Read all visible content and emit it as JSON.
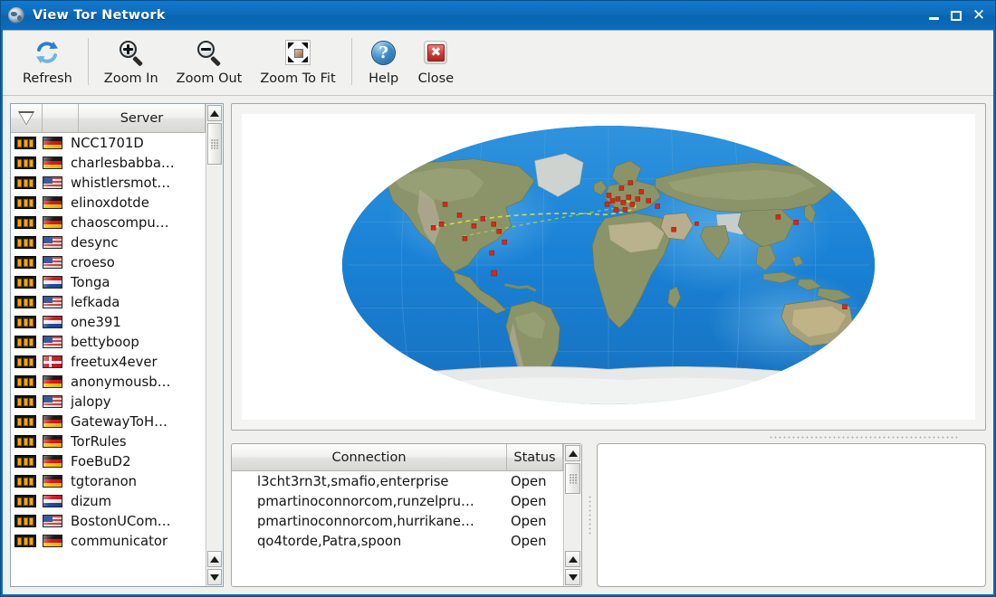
{
  "window": {
    "title": "View Tor Network",
    "icon": "globe-icon",
    "controls": {
      "minimize": "–",
      "maximize": "□",
      "close": "✕"
    },
    "titlebar_color": "#0e6cbb"
  },
  "toolbar": {
    "items": [
      {
        "label": "Refresh",
        "icon": "refresh-icon"
      },
      {
        "label": "Zoom In",
        "icon": "zoom-in-icon"
      },
      {
        "label": "Zoom Out",
        "icon": "zoom-out-icon"
      },
      {
        "label": "Zoom To Fit",
        "icon": "zoom-to-fit-icon"
      },
      {
        "label": "Help",
        "icon": "help-icon"
      },
      {
        "label": "Close",
        "icon": "close-icon"
      }
    ]
  },
  "server_list": {
    "columns": {
      "filter": "",
      "flag": "",
      "server": "Server"
    },
    "filter_icon": "filter-triangle-icon",
    "rows": [
      {
        "server": "NCC1701D",
        "flag": "de",
        "bandwidth": 3
      },
      {
        "server": "charlesbabba…",
        "flag": "de",
        "bandwidth": 3
      },
      {
        "server": "whistlersmot…",
        "flag": "us",
        "bandwidth": 3
      },
      {
        "server": "elinoxdotde",
        "flag": "de",
        "bandwidth": 3
      },
      {
        "server": "chaoscompu…",
        "flag": "de",
        "bandwidth": 3
      },
      {
        "server": "desync",
        "flag": "us",
        "bandwidth": 3
      },
      {
        "server": "croeso",
        "flag": "us",
        "bandwidth": 3
      },
      {
        "server": "Tonga",
        "flag": "nl",
        "bandwidth": 3
      },
      {
        "server": "lefkada",
        "flag": "us",
        "bandwidth": 3
      },
      {
        "server": "one391",
        "flag": "nl",
        "bandwidth": 3
      },
      {
        "server": "bettyboop",
        "flag": "us",
        "bandwidth": 3
      },
      {
        "server": "freetux4ever",
        "flag": "dk",
        "bandwidth": 3
      },
      {
        "server": "anonymousb…",
        "flag": "de",
        "bandwidth": 3
      },
      {
        "server": "jalopy",
        "flag": "us",
        "bandwidth": 3
      },
      {
        "server": "GatewayToH…",
        "flag": "de",
        "bandwidth": 3
      },
      {
        "server": "TorRules",
        "flag": "de",
        "bandwidth": 3
      },
      {
        "server": "FoeBuD2",
        "flag": "de",
        "bandwidth": 3
      },
      {
        "server": "tgtoranon",
        "flag": "de",
        "bandwidth": 3
      },
      {
        "server": "dizum",
        "flag": "nl",
        "bandwidth": 3
      },
      {
        "server": "BostonUCom…",
        "flag": "us",
        "bandwidth": 3
      },
      {
        "server": "communicator",
        "flag": "de",
        "bandwidth": 3
      }
    ],
    "scrollbar": {
      "up": "▲",
      "down": "▼"
    }
  },
  "map": {
    "name": "world-map",
    "projection": "robinson",
    "ocean_color": "#1a7fd4",
    "land_color": "#7f8f62",
    "marker_color": "#d42a18",
    "background": "#ffffff"
  },
  "connections": {
    "columns": {
      "connection": "Connection",
      "status": "Status"
    },
    "rows": [
      {
        "connection": "l3cht3rn3t,smafio,enterprise",
        "status": "Open"
      },
      {
        "connection": "pmartinoconnorcom,runzelpru…",
        "status": "Open"
      },
      {
        "connection": "pmartinoconnorcom,hurrikane…",
        "status": "Open"
      },
      {
        "connection": "qo4torde,Patra,spoon",
        "status": "Open"
      }
    ],
    "scrollbar": {
      "up": "▲",
      "down": "▼"
    }
  },
  "detail_panel": {
    "name": "connection-detail-panel",
    "content": ""
  }
}
